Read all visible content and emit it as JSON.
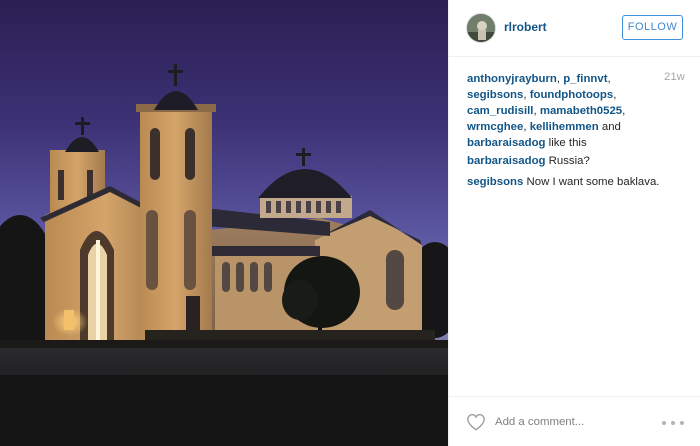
{
  "post": {
    "author": "rlrobert",
    "follow_label": "FOLLOW",
    "timestamp": "21w",
    "likes": {
      "users": [
        "anthonyjrayburn",
        "p_finnvt",
        "segibsons",
        "foundphotoops",
        "cam_rudisill",
        "mamabeth0525",
        "wrmcghee",
        "kellihemmen"
      ],
      "connector": "and",
      "last_user": "barbaraisadog",
      "suffix": "like this"
    },
    "comments": [
      {
        "user": "barbaraisadog",
        "text": "Russia?"
      },
      {
        "user": "segibsons",
        "text": "Now I want some baklava."
      }
    ],
    "comment_placeholder": "Add a comment...",
    "icons": {
      "like": "heart-icon",
      "more": "more-options-icon"
    }
  },
  "colors": {
    "username": "#125688",
    "follow_border": "#4090db",
    "timestamp": "#a5a7aa"
  }
}
